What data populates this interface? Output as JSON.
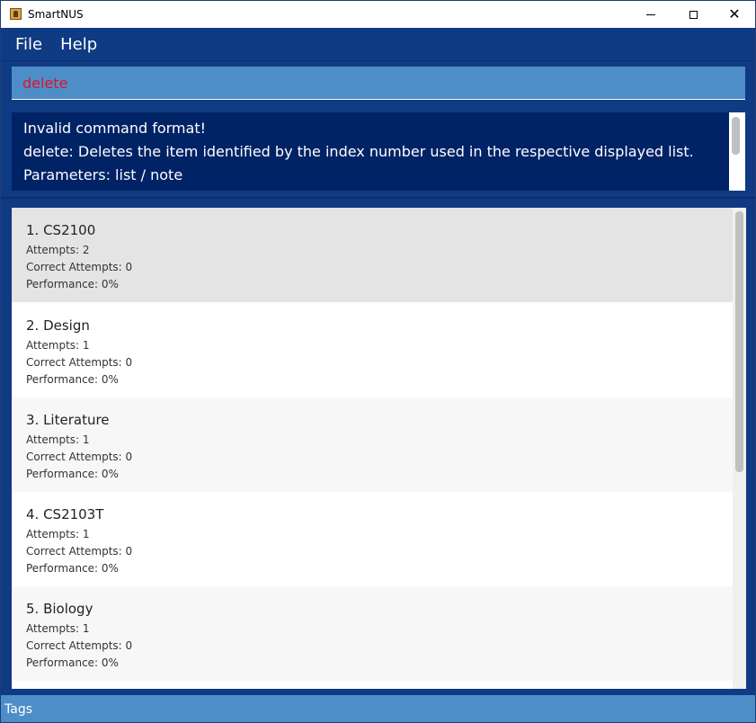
{
  "window": {
    "title": "SmartNUS",
    "minimize_glyph": "minimize-icon",
    "maximize_glyph": "maximize-icon",
    "close_glyph": "✕"
  },
  "menu": {
    "items": [
      {
        "label": "File"
      },
      {
        "label": "Help"
      }
    ]
  },
  "command": {
    "value": "delete"
  },
  "result": {
    "lines": [
      "Invalid command format!",
      "delete: Deletes the item identified by the index number used in the respective displayed list.",
      "Parameters: list / note"
    ]
  },
  "list": {
    "cards": [
      {
        "title": "1.  CS2100",
        "attempts": "Attempts: 2",
        "correct": "Correct Attempts: 0",
        "performance": "Performance: 0%"
      },
      {
        "title": "2.  Design",
        "attempts": "Attempts: 1",
        "correct": "Correct Attempts: 0",
        "performance": "Performance: 0%"
      },
      {
        "title": "3.  Literature",
        "attempts": "Attempts: 1",
        "correct": "Correct Attempts: 0",
        "performance": "Performance: 0%"
      },
      {
        "title": "4.  CS2103T",
        "attempts": "Attempts: 1",
        "correct": "Correct Attempts: 0",
        "performance": "Performance: 0%"
      },
      {
        "title": "5.  Biology",
        "attempts": "Attempts: 1",
        "correct": "Correct Attempts: 0",
        "performance": "Performance: 0%"
      }
    ]
  },
  "status": {
    "text": "Tags"
  },
  "colors": {
    "window_bg": "#0f3a84",
    "command_bg": "#4d8ec8",
    "command_text": "#e0112b",
    "result_bg": "#002366",
    "card_selected": "#e4e4e4",
    "card_alt": "#f7f7f7",
    "card_plain": "#ffffff",
    "status_bg": "#4d8ec8"
  }
}
